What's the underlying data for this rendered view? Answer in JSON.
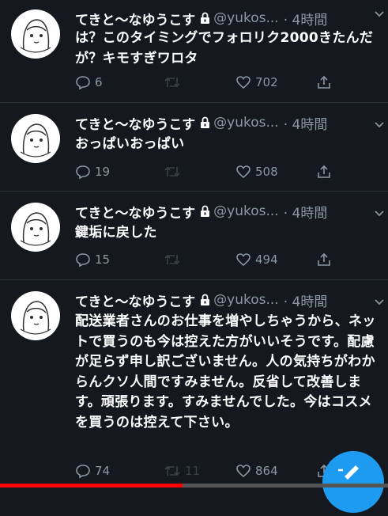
{
  "colors": {
    "accent": "#1d9bf0",
    "muted": "#8b98a5",
    "progress": "#ff0000"
  },
  "tweets": [
    {
      "name": "てきと〜なゆうこす",
      "handle": "@yukos...",
      "time": "· 4時間",
      "text": "は？このタイミングでフォロリク2000きたんだが？キモすぎワロタ",
      "replies": "6",
      "retweets": "",
      "likes": "702"
    },
    {
      "name": "てきと〜なゆうこす",
      "handle": "@yukos...",
      "time": "· 4時間",
      "text": "おっぱいおっぱい",
      "replies": "19",
      "retweets": "",
      "likes": "508"
    },
    {
      "name": "てきと〜なゆうこす",
      "handle": "@yukos...",
      "time": "· 4時間",
      "text": "鍵垢に戻した",
      "replies": "15",
      "retweets": "",
      "likes": "494"
    },
    {
      "name": "てきと〜なゆうこす",
      "handle": "@yukos...",
      "time": "· 4時間",
      "text": "配送業者さんのお仕事を増やしちゃうから、ネットで買うのも今は控えた方がいいそうです。配慮が足らず申し訳ございません。人の気持ちがわからんクソ人間ですみません。反省して改善します。頑張ります。すみませんでした。今はコスメを買うのは控えて下さい。",
      "replies": "74",
      "retweets": "11",
      "likes": "864"
    }
  ],
  "icons": {
    "lock": "lock-icon",
    "reply": "reply-icon",
    "retweet": "retweet-icon",
    "like": "heart-icon",
    "share": "share-icon",
    "more": "chevron-down-icon",
    "compose": "compose-icon"
  },
  "video_progress": 0.47
}
